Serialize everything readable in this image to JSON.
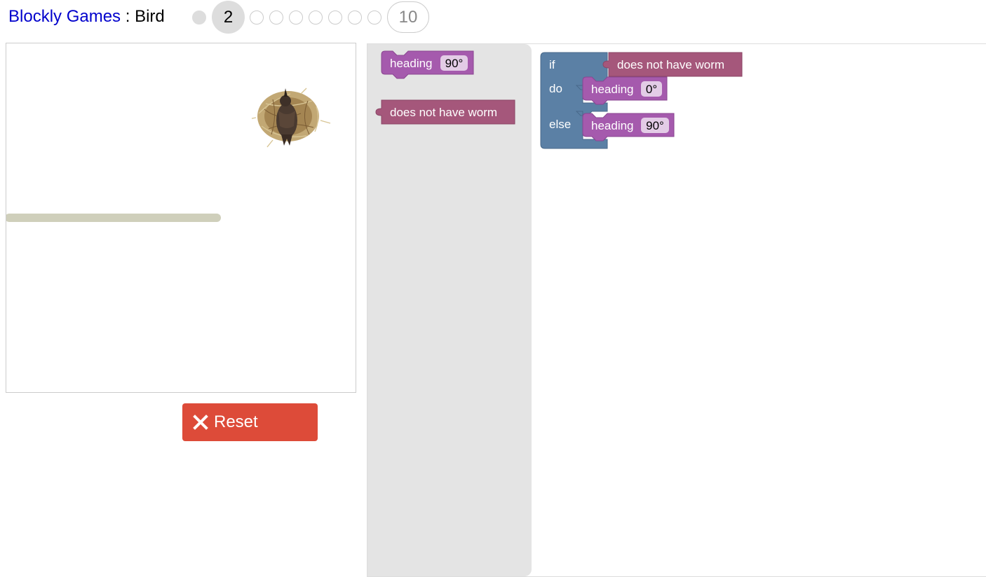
{
  "header": {
    "app_name": "Blockly Games",
    "separator": " : ",
    "game_name": "Bird",
    "current_level": "2",
    "last_level": "10"
  },
  "reset": {
    "label": "Reset"
  },
  "toolbox": {
    "heading_label": "heading",
    "heading_value": "90°",
    "condition_label": "does not have worm"
  },
  "program": {
    "if_label": "if",
    "do_label": "do",
    "else_label": "else",
    "condition_label": "does not have worm",
    "do_heading_label": "heading",
    "do_heading_value": "0°",
    "else_heading_label": "heading",
    "else_heading_value": "90°"
  },
  "colors": {
    "link": "#0000cc",
    "reset_button": "#dd4b39",
    "toolbox_bg": "#e4e4e4",
    "heading_block": "#a55aad",
    "condition_block": "#a5577b",
    "control_block": "#5b80a5",
    "wall": "#cfcfbb"
  },
  "icons": {
    "reset": "close-icon",
    "bird": "bird-icon",
    "nest": "nest-icon"
  }
}
